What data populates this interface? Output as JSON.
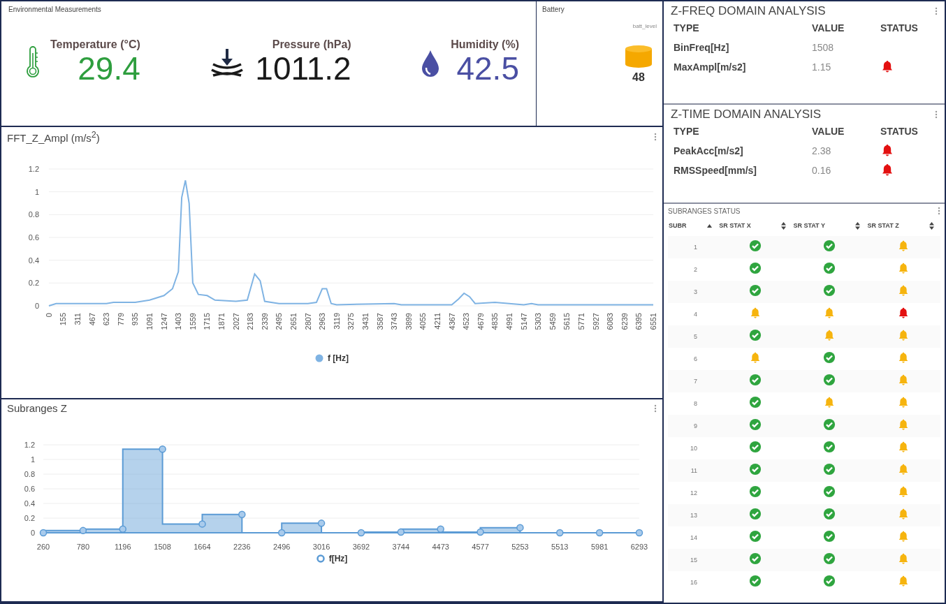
{
  "environment": {
    "title": "Environmental Measurements",
    "metrics": [
      {
        "kind": "thermometer",
        "label": "Temperature (°C)",
        "value": "29.4",
        "color": "#2e9e3e"
      },
      {
        "kind": "pressure",
        "label": "Pressure (hPa)",
        "value": "1011.2",
        "color": "#1a1a1a"
      },
      {
        "kind": "drop",
        "label": "Humidity (%)",
        "value": "42.5",
        "color": "#4a4fa3"
      }
    ]
  },
  "battery": {
    "title": "Battery",
    "label": "batt_level",
    "value": "48"
  },
  "fft_panel": {
    "chart_data": {
      "type": "line",
      "title": "FFT_Z_Ampl (m/s$^{2}$)",
      "grid": true,
      "x": [
        0,
        78,
        623,
        700,
        935,
        1091,
        1247,
        1340,
        1403,
        1440,
        1480,
        1520,
        1559,
        1620,
        1715,
        1800,
        2027,
        2150,
        2230,
        2290,
        2339,
        2495,
        2807,
        2900,
        2963,
        3010,
        3060,
        3119,
        3743,
        3820,
        4367,
        4440,
        4500,
        4560,
        4620,
        4835,
        5147,
        5230,
        5303,
        6551
      ],
      "series": [
        {
          "name": "f [Hz]",
          "color": "#7fb3e3",
          "values": [
            0,
            0.02,
            0.02,
            0.03,
            0.03,
            0.05,
            0.09,
            0.15,
            0.3,
            0.95,
            1.1,
            0.9,
            0.2,
            0.1,
            0.09,
            0.05,
            0.04,
            0.05,
            0.28,
            0.22,
            0.04,
            0.02,
            0.02,
            0.03,
            0.15,
            0.15,
            0.02,
            0.01,
            0.02,
            0.01,
            0.01,
            0.06,
            0.11,
            0.08,
            0.02,
            0.03,
            0.01,
            0.02,
            0.01,
            0.01
          ]
        }
      ],
      "xlim": [
        0,
        6551
      ],
      "ylim": [
        0,
        1.2
      ],
      "yticks": [
        0,
        0.2,
        0.4,
        0.6,
        0.8,
        1,
        1.2
      ],
      "xticks": [
        0,
        155,
        311,
        467,
        623,
        779,
        935,
        1091,
        1247,
        1403,
        1559,
        1715,
        1871,
        2027,
        2183,
        2339,
        2495,
        2651,
        2807,
        2963,
        3119,
        3275,
        3431,
        3587,
        3743,
        3899,
        4055,
        4211,
        4367,
        4523,
        4679,
        4835,
        4991,
        5147,
        5303,
        5459,
        5615,
        5771,
        5927,
        6083,
        6239,
        6395,
        6551
      ]
    }
  },
  "subranges_panel": {
    "chart_data": {
      "type": "area",
      "title": "Subranges Z",
      "grid": true,
      "categories": [
        "260",
        "780",
        "1196",
        "1508",
        "1664",
        "2236",
        "2496",
        "3016",
        "3692",
        "3744",
        "4473",
        "4577",
        "5253",
        "5513",
        "5981",
        "6293"
      ],
      "series": [
        {
          "name": "f[Hz]",
          "color": "#5b9bd5",
          "values": [
            0,
            0.03,
            0.05,
            1.14,
            0.12,
            0.25,
            0,
            0.13,
            0,
            0.01,
            0.05,
            0.01,
            0.07,
            0,
            0,
            0
          ]
        }
      ],
      "ylim": [
        0,
        1.2
      ],
      "yticks": [
        0,
        0.2,
        0.4,
        0.6,
        0.8,
        1,
        1.2
      ]
    }
  },
  "freq_analysis": {
    "title": "Z-FREQ DOMAIN ANALYSIS",
    "columns": [
      "TYPE",
      "VALUE",
      "STATUS"
    ],
    "rows": [
      {
        "type": "BinFreq[Hz]",
        "value": "1508",
        "alarm": false
      },
      {
        "type": "MaxAmpl[m/s2]",
        "value": "1.15",
        "alarm": true
      }
    ]
  },
  "time_analysis": {
    "title": "Z-TIME DOMAIN ANALYSIS",
    "columns": [
      "TYPE",
      "VALUE",
      "STATUS"
    ],
    "rows": [
      {
        "type": "PeakAcc[m/s2]",
        "value": "2.38",
        "alarm": true
      },
      {
        "type": "RMSSpeed[mm/s]",
        "value": "0.16",
        "alarm": true
      }
    ]
  },
  "subranges_status": {
    "title": "SUBRANGES STATUS",
    "columns": [
      {
        "label": "SUBR",
        "sorted": true
      },
      {
        "label": "SR STAT X",
        "sorted": false
      },
      {
        "label": "SR STAT Y",
        "sorted": false
      },
      {
        "label": "SR STAT Z",
        "sorted": false
      }
    ],
    "rows": [
      {
        "subr": "1",
        "cells": [
          {
            "kind": "ok"
          },
          {
            "kind": "ok"
          },
          {
            "kind": "warning"
          }
        ]
      },
      {
        "subr": "2",
        "cells": [
          {
            "kind": "ok"
          },
          {
            "kind": "ok"
          },
          {
            "kind": "warning"
          }
        ]
      },
      {
        "subr": "3",
        "cells": [
          {
            "kind": "ok"
          },
          {
            "kind": "ok"
          },
          {
            "kind": "warning"
          }
        ]
      },
      {
        "subr": "4",
        "cells": [
          {
            "kind": "warning"
          },
          {
            "kind": "warning"
          },
          {
            "kind": "alarm"
          }
        ]
      },
      {
        "subr": "5",
        "cells": [
          {
            "kind": "ok"
          },
          {
            "kind": "warning"
          },
          {
            "kind": "warning"
          }
        ]
      },
      {
        "subr": "6",
        "cells": [
          {
            "kind": "warning"
          },
          {
            "kind": "ok"
          },
          {
            "kind": "warning"
          }
        ]
      },
      {
        "subr": "7",
        "cells": [
          {
            "kind": "ok"
          },
          {
            "kind": "ok"
          },
          {
            "kind": "warning"
          }
        ]
      },
      {
        "subr": "8",
        "cells": [
          {
            "kind": "ok"
          },
          {
            "kind": "warning"
          },
          {
            "kind": "warning"
          }
        ]
      },
      {
        "subr": "9",
        "cells": [
          {
            "kind": "ok"
          },
          {
            "kind": "ok"
          },
          {
            "kind": "warning"
          }
        ]
      },
      {
        "subr": "10",
        "cells": [
          {
            "kind": "ok"
          },
          {
            "kind": "ok"
          },
          {
            "kind": "warning"
          }
        ]
      },
      {
        "subr": "11",
        "cells": [
          {
            "kind": "ok"
          },
          {
            "kind": "ok"
          },
          {
            "kind": "warning"
          }
        ]
      },
      {
        "subr": "12",
        "cells": [
          {
            "kind": "ok"
          },
          {
            "kind": "ok"
          },
          {
            "kind": "warning"
          }
        ]
      },
      {
        "subr": "13",
        "cells": [
          {
            "kind": "ok"
          },
          {
            "kind": "ok"
          },
          {
            "kind": "warning"
          }
        ]
      },
      {
        "subr": "14",
        "cells": [
          {
            "kind": "ok"
          },
          {
            "kind": "ok"
          },
          {
            "kind": "warning"
          }
        ]
      },
      {
        "subr": "15",
        "cells": [
          {
            "kind": "ok"
          },
          {
            "kind": "ok"
          },
          {
            "kind": "warning"
          }
        ]
      },
      {
        "subr": "16",
        "cells": [
          {
            "kind": "ok"
          },
          {
            "kind": "ok"
          },
          {
            "kind": "warning"
          }
        ]
      }
    ]
  }
}
